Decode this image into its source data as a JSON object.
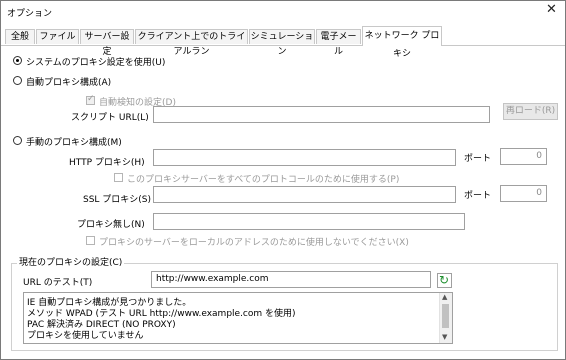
{
  "window": {
    "title": "オプション",
    "close_glyph": "✕"
  },
  "tabs": [
    {
      "label": "全般"
    },
    {
      "label": "ファイル"
    },
    {
      "label": "サーバー設定"
    },
    {
      "label": "クライアント上でのトライアルラン"
    },
    {
      "label": "シミュレーション"
    },
    {
      "label": "電子メール"
    },
    {
      "label": "ネットワーク プロキシ",
      "active": true
    }
  ],
  "proxy": {
    "system_radio": "システムのプロキシ設定を使用(U)",
    "auto_radio": "自動プロキシ構成(A)",
    "auto_detect": "自動検知の設定(D)",
    "script_url_label": "スクリプト URL(L)",
    "script_url_value": "",
    "reload_button": "再ロード(R)",
    "manual_radio": "手動のプロキシ構成(M)",
    "http_label": "HTTP プロキシ(H)",
    "http_value": "",
    "port_label": "ポート",
    "http_port": "0",
    "use_all_protocols": "このプロキシサーバーをすべてのプロトコールのために使用する(P)",
    "ssl_label": "SSL プロキシ(S)",
    "ssl_value": "",
    "ssl_port": "0",
    "no_proxy_label": "プロキシ無し(N)",
    "no_proxy_value": "",
    "bypass_local": "プロキシのサーバーをローカルのアドレスのために使用しないでください(X)"
  },
  "current": {
    "group_title": "現在のプロキシの設定(C)",
    "url_test_label": "URL のテスト(T)",
    "url_test_value": "http://www.example.com",
    "refresh_icon": "refresh-icon",
    "output_lines": [
      "IE 自動プロキシ構成が見つかりました。",
      "メソッド WPAD (テスト URL http://www.example.com を使用)",
      "PAC 解決済み DIRECT (NO PROXY)",
      "プロキシを使用していません"
    ]
  },
  "colors": {
    "refresh_green": "#1e8f2e",
    "disabled_text": "#9a9a9a",
    "border": "#a0a0a0"
  }
}
